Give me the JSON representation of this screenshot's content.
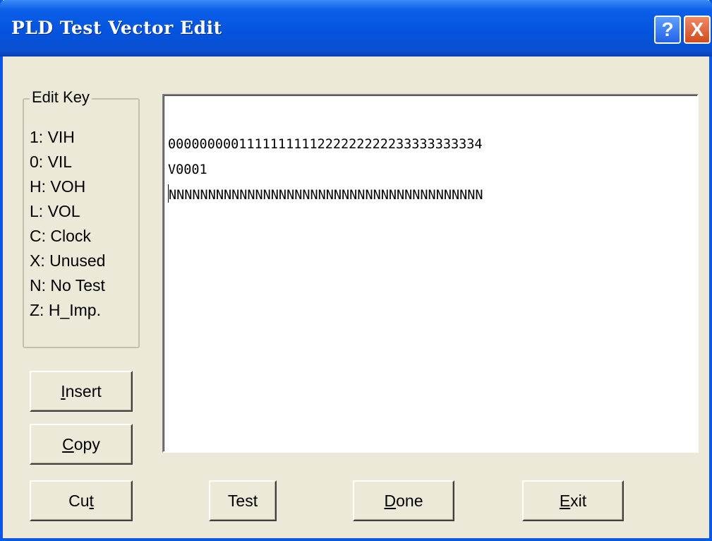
{
  "window": {
    "title": "PLD Test Vector Edit"
  },
  "titlebar_buttons": {
    "help": "?",
    "close": "X"
  },
  "edit_key": {
    "title": "Edit Key",
    "items": [
      "1: VIH",
      "0: VIL",
      "H: VOH",
      "L: VOL",
      "C: Clock",
      "X: Unused",
      "N: No Test",
      "Z: H_Imp."
    ]
  },
  "side_buttons": {
    "insert": {
      "pre": "",
      "mnemonic": "I",
      "post": "nsert"
    },
    "copy": {
      "pre": "",
      "mnemonic": "C",
      "post": "opy"
    },
    "cut": {
      "pre": "Cu",
      "mnemonic": "t",
      "post": ""
    }
  },
  "editor": {
    "lines": [
      "0000000001111111111222222222233333333334",
      "V0001",
      "NNNNNNNNNNNNNNNNNNNNNNNNNNNNNNNNNNNNNNNN"
    ]
  },
  "bottom_buttons": {
    "test": {
      "pre": "Test",
      "mnemonic": "",
      "post": ""
    },
    "done": {
      "pre": "",
      "mnemonic": "D",
      "post": "one"
    },
    "exit": {
      "pre": "",
      "mnemonic": "E",
      "post": "xit"
    }
  }
}
